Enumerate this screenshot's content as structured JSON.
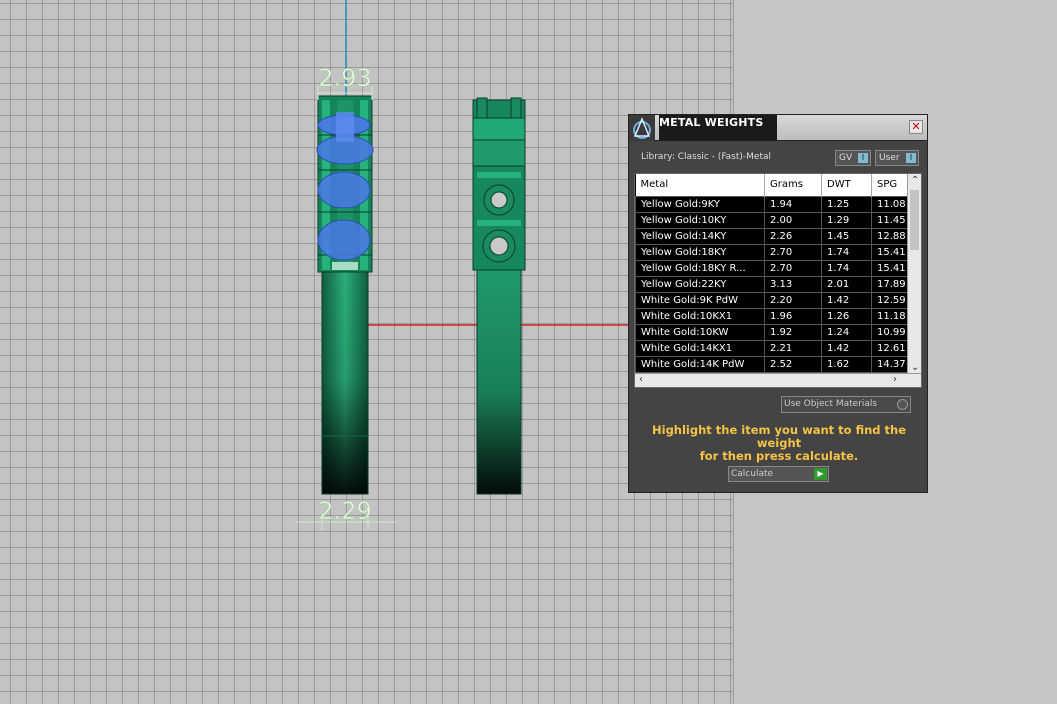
{
  "viewport": {
    "dimension_top": "2.93",
    "dimension_bottom": "2.29"
  },
  "dialog": {
    "title": "METAL WEIGHTS",
    "close_icon": "close-x",
    "library_label": "Library: Classic - (Fast)-Metal",
    "toggle_gv": "GV",
    "toggle_user": "User",
    "columns": [
      "Metal",
      "Grams",
      "DWT",
      "SPG"
    ],
    "rows": [
      [
        "Yellow Gold:9KY",
        "1.94",
        "1.25",
        "11.08"
      ],
      [
        "Yellow Gold:10KY",
        "2.00",
        "1.29",
        "11.45"
      ],
      [
        "Yellow Gold:14KY",
        "2.26",
        "1.45",
        "12.88"
      ],
      [
        "Yellow Gold:18KY",
        "2.70",
        "1.74",
        "15.41"
      ],
      [
        "Yellow Gold:18KY R...",
        "2.70",
        "1.74",
        "15.41"
      ],
      [
        "Yellow Gold:22KY",
        "3.13",
        "2.01",
        "17.89"
      ],
      [
        "White Gold:9K PdW",
        "2.20",
        "1.42",
        "12.59"
      ],
      [
        "White Gold:10KX1",
        "1.96",
        "1.26",
        "11.18"
      ],
      [
        "White Gold:10KW",
        "1.92",
        "1.24",
        "10.99"
      ],
      [
        "White Gold:14KX1",
        "2.21",
        "1.42",
        "12.61"
      ],
      [
        "White Gold:14K PdW",
        "2.52",
        "1.62",
        "14.37"
      ]
    ],
    "use_object_materials": "Use Object Materials",
    "hint_line1": "Highlight the item you want to find the weight",
    "hint_line2": "for then press calculate.",
    "calculate_label": "Calculate",
    "colors": {
      "hint": "#f6c445",
      "ring": "#1f9f6a",
      "stone": "#4a78e8",
      "axis_x": "#c8281e",
      "axis_y": "#2a8fc0"
    }
  }
}
